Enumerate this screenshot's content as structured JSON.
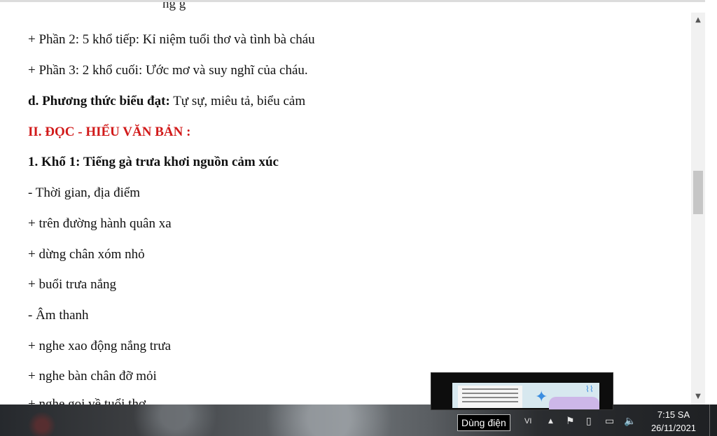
{
  "document": {
    "cut_line": "ng g",
    "lines": [
      {
        "text": "+ Phần 2: 5 khổ tiếp: Kỉ niệm tuổi thơ và tình bà cháu"
      },
      {
        "text": "+ Phần 3: 2 khổ cuối: Ước mơ và suy nghĩ của cháu."
      },
      {
        "bold": "d. Phương thức biểu đạt:",
        "text": " Tự sự, miêu tả, biểu cảm"
      },
      {
        "heading": "II. ĐỌC - HIỂU VĂN BẢN :"
      },
      {
        "bold": "1. Khổ 1: Tiếng gà trưa khơi nguồn cảm xúc"
      },
      {
        "text": "- Thời gian, địa điểm"
      },
      {
        "text": "+ trên đường hành quân xa"
      },
      {
        "text": "+ dừng chân xóm nhỏ"
      },
      {
        "text": "+ buổi trưa nắng"
      },
      {
        "text": "- Âm thanh"
      },
      {
        "text": "+ nghe xao động nắng trưa"
      },
      {
        "text": "+  nghe bàn chân đỡ mỏi"
      },
      {
        "text": "+  nghe gọi về tuổi thơ"
      }
    ]
  },
  "scrollbar": {
    "up_icon": "up-arrow-icon",
    "down_icon": "down-arrow-icon"
  },
  "taskbar": {
    "tooltip": "Dùng điện",
    "language": "VI",
    "icons": [
      "show-hidden-icons-icon",
      "action-center-flag-icon",
      "power-plug-icon",
      "network-icon",
      "volume-icon"
    ],
    "clock_time": "7:15 SA",
    "clock_date": "26/11/2021"
  },
  "colors": {
    "heading": "#d11a1a",
    "text": "#111111"
  }
}
